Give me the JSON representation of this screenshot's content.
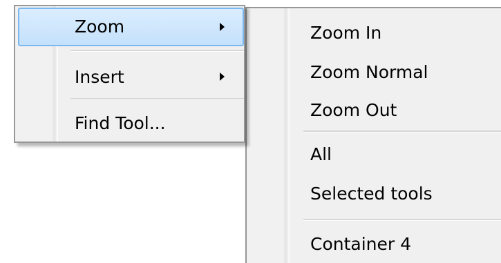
{
  "context_menu": {
    "items": [
      {
        "label": "Zoom",
        "has_submenu": true,
        "highlighted": true
      },
      {
        "label": "Insert",
        "has_submenu": true,
        "highlighted": false
      },
      {
        "label": "Find Tool...",
        "has_submenu": false,
        "highlighted": false
      }
    ]
  },
  "zoom_submenu": {
    "items": [
      {
        "label": "Zoom In"
      },
      {
        "label": "Zoom Normal"
      },
      {
        "label": "Zoom Out"
      },
      {
        "label": "All"
      },
      {
        "label": "Selected tools"
      },
      {
        "label": "Container 4"
      }
    ]
  },
  "colors": {
    "highlight_fill": "#c4e0fb",
    "highlight_border": "#7db7ef",
    "menu_background": "#f0f0f0",
    "menu_border": "#979797"
  },
  "icons": {
    "submenu_arrow": "triangle-right-icon"
  }
}
